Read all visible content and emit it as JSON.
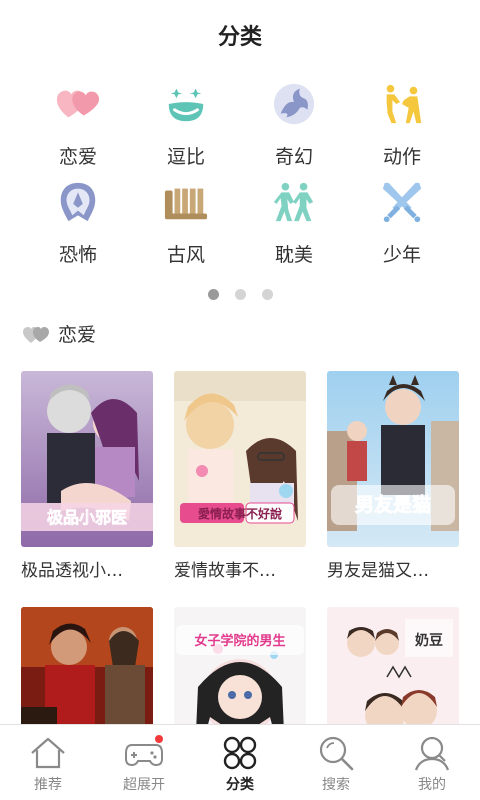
{
  "header": {
    "title": "分类"
  },
  "categories": [
    {
      "label": "恋爱",
      "icon": "hearts-icon",
      "color": "#f4a4b2"
    },
    {
      "label": "逗比",
      "icon": "funny-face-icon",
      "color": "#5ec4b6"
    },
    {
      "label": "奇幻",
      "icon": "dragon-icon",
      "color": "#8a95c8"
    },
    {
      "label": "动作",
      "icon": "fighters-icon",
      "color": "#f4c73c"
    },
    {
      "label": "恐怖",
      "icon": "ghost-icon",
      "color": "#8a95c8"
    },
    {
      "label": "古风",
      "icon": "scroll-icon",
      "color": "#c9a877"
    },
    {
      "label": "耽美",
      "icon": "two-people-icon",
      "color": "#7fd2c2"
    },
    {
      "label": "少年",
      "icon": "crossed-swords-icon",
      "color": "#9fc6ec"
    }
  ],
  "pager": {
    "count": 3,
    "active": 0
  },
  "section": {
    "title": "恋爱"
  },
  "comics": [
    {
      "title": "极品透视小…",
      "cover_text": "极品小邪医"
    },
    {
      "title": "爱情故事不…",
      "cover_text": "愛情故事不好說"
    },
    {
      "title": "男友是猫又…",
      "cover_text": "男友是猫"
    },
    {
      "title": "",
      "cover_text": ""
    },
    {
      "title": "",
      "cover_text": "女子学院的男生"
    },
    {
      "title": "",
      "cover_text": "奶豆"
    }
  ],
  "tabs": [
    {
      "label": "推荐",
      "icon": "home-icon",
      "active": false,
      "badge": false
    },
    {
      "label": "超展开",
      "icon": "gamepad-icon",
      "active": false,
      "badge": true
    },
    {
      "label": "分类",
      "icon": "category-icon",
      "active": true,
      "badge": false
    },
    {
      "label": "搜索",
      "icon": "search-icon",
      "active": false,
      "badge": false
    },
    {
      "label": "我的",
      "icon": "profile-icon",
      "active": false,
      "badge": false
    }
  ]
}
